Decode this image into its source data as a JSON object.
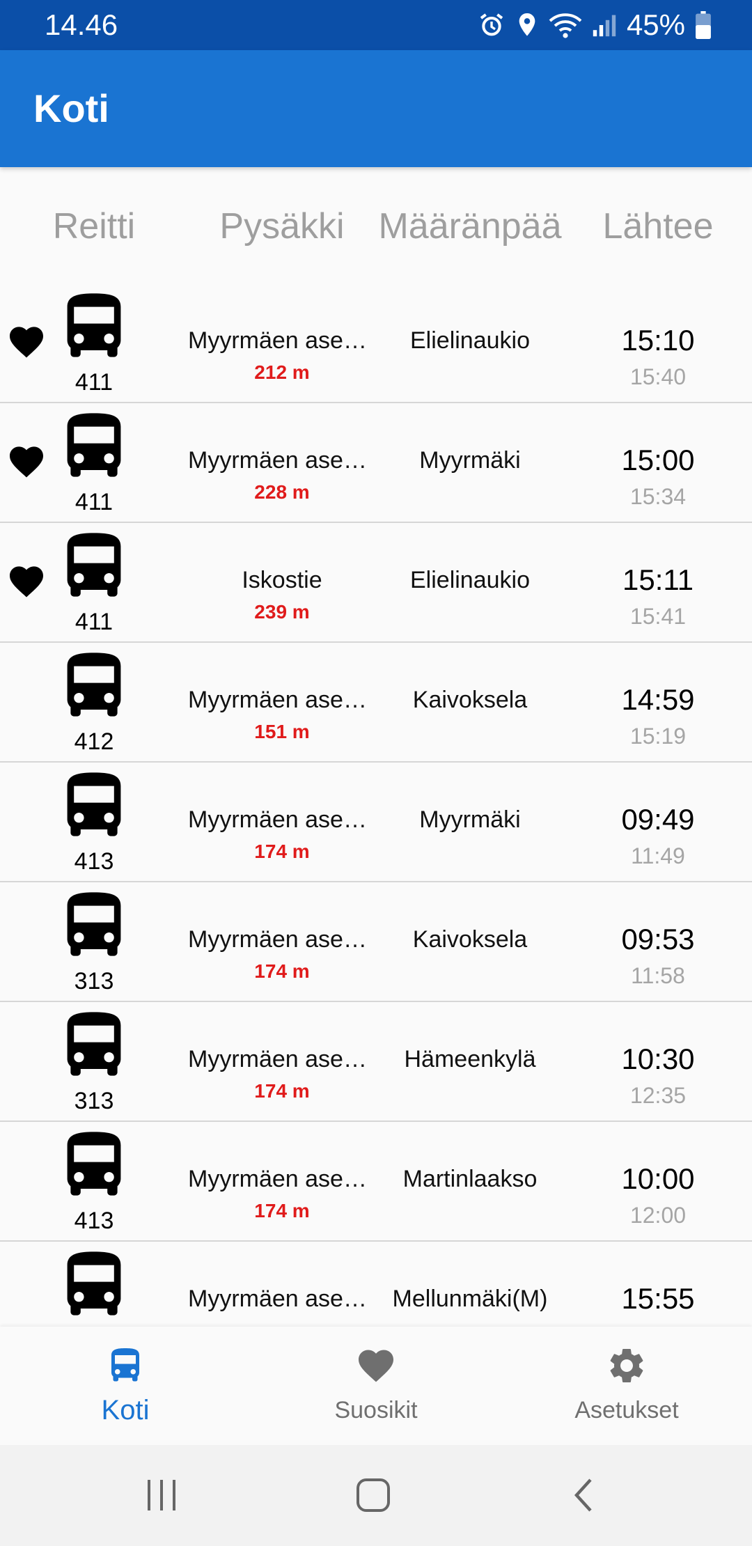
{
  "status_bar": {
    "time": "14.46",
    "battery": "45%",
    "icons": [
      "alarm-icon",
      "location-icon",
      "wifi-icon",
      "signal-icon",
      "battery-icon"
    ]
  },
  "app_bar": {
    "title": "Koti"
  },
  "columns": {
    "route": "Reitti",
    "stop": "Pysäkki",
    "destination": "Määränpää",
    "departs": "Lähtee"
  },
  "departures": [
    {
      "favorite": true,
      "route": "411",
      "stop": "Myyrmäen asema",
      "distance": "212 m",
      "destination": "Elielinaukio",
      "departure": "15:10",
      "next": "15:40"
    },
    {
      "favorite": true,
      "route": "411",
      "stop": "Myyrmäen asema",
      "distance": "228 m",
      "destination": "Myyrmäki",
      "departure": "15:00",
      "next": "15:34"
    },
    {
      "favorite": true,
      "route": "411",
      "stop": "Iskostie",
      "distance": "239 m",
      "destination": "Elielinaukio",
      "departure": "15:11",
      "next": "15:41"
    },
    {
      "favorite": false,
      "route": "412",
      "stop": "Myyrmäen asema",
      "distance": "151 m",
      "destination": "Kaivoksela",
      "departure": "14:59",
      "next": "15:19"
    },
    {
      "favorite": false,
      "route": "413",
      "stop": "Myyrmäen asema",
      "distance": "174 m",
      "destination": "Myyrmäki",
      "departure": "09:49",
      "next": "11:49"
    },
    {
      "favorite": false,
      "route": "313",
      "stop": "Myyrmäen asema",
      "distance": "174 m",
      "destination": "Kaivoksela",
      "departure": "09:53",
      "next": "11:58"
    },
    {
      "favorite": false,
      "route": "313",
      "stop": "Myyrmäen asema",
      "distance": "174 m",
      "destination": "Hämeenkylä",
      "departure": "10:30",
      "next": "12:35"
    },
    {
      "favorite": false,
      "route": "413",
      "stop": "Myyrmäen asema",
      "distance": "174 m",
      "destination": "Martinlaakso",
      "departure": "10:00",
      "next": "12:00"
    },
    {
      "favorite": false,
      "route": "",
      "stop": "Myyrmäen asema",
      "distance": "",
      "destination": "Mellunmäki(M)",
      "departure": "15:55",
      "next": ""
    }
  ],
  "bottom_nav": {
    "items": [
      {
        "label": "Koti",
        "icon": "bus-icon",
        "active": true
      },
      {
        "label": "Suosikit",
        "icon": "heart-icon",
        "active": false
      },
      {
        "label": "Asetukset",
        "icon": "gear-icon",
        "active": false
      }
    ],
    "active_color": "#1a74d2",
    "inactive_color": "#6f6f6f"
  },
  "colors": {
    "status_bar": "#0b4fa8",
    "app_bar": "#1a74d2",
    "distance": "#e01b1b"
  },
  "system_nav": [
    "recents-icon",
    "home-icon",
    "back-icon"
  ]
}
